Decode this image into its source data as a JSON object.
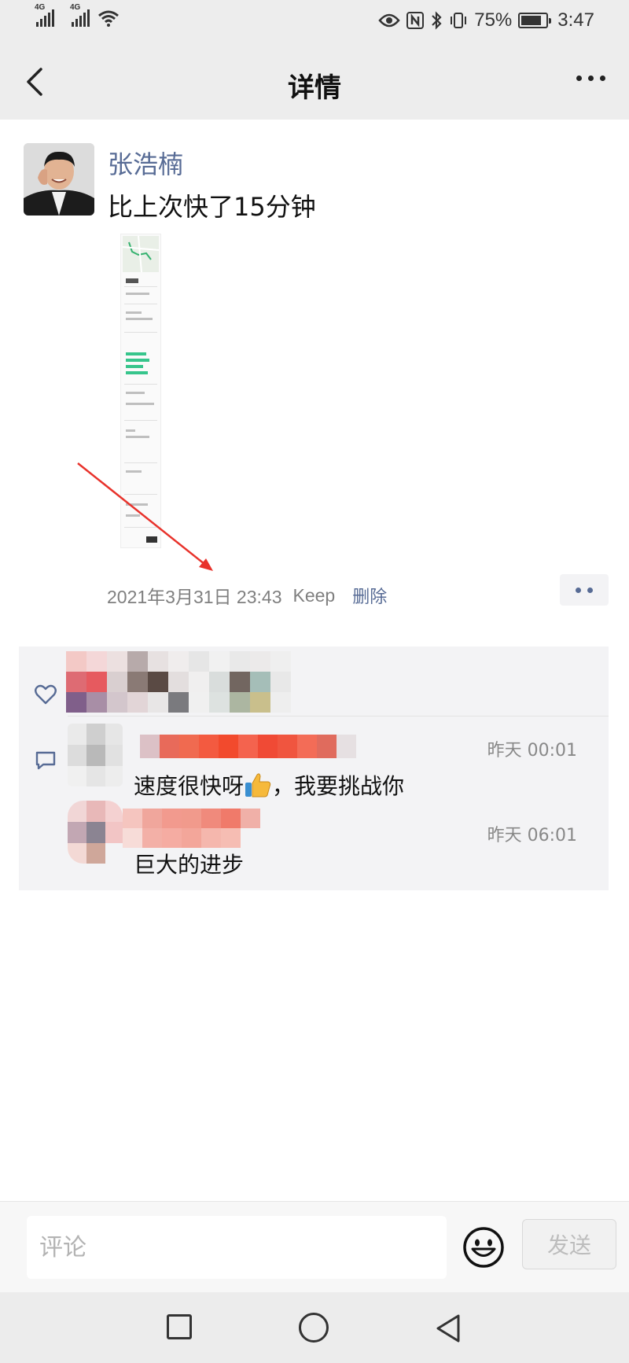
{
  "status_bar": {
    "signal1_label": "4G",
    "signal2_label": "4G",
    "battery_percent": "75%",
    "time": "3:47"
  },
  "nav": {
    "title": "详情"
  },
  "post": {
    "author": "张浩楠",
    "text": "比上次快了15分钟",
    "timestamp": "2021年3月31日 23:43",
    "source": "Keep",
    "delete_label": "删除"
  },
  "comments": [
    {
      "time": "昨天 00:01",
      "text_before": "速度很快呀",
      "text_after": "，我要挑战你"
    },
    {
      "time": "昨天 06:01",
      "text": "巨大的进步"
    }
  ],
  "input": {
    "placeholder": "评论",
    "send_label": "发送"
  },
  "colors": {
    "link": "#576b95",
    "panel": "#f3f3f5",
    "annotation_arrow": "#e8322b"
  }
}
